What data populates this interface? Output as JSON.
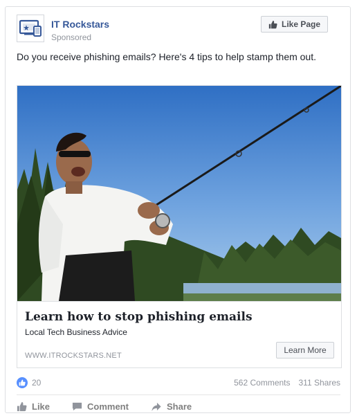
{
  "post": {
    "page_name": "IT Rockstars",
    "sponsored_label": "Sponsored",
    "like_page_label": "Like Page",
    "text": "Do you receive phishing emails? Here's 4 tips to help stamp them out."
  },
  "link_preview": {
    "title": "Learn how to stop phishing emails",
    "description": "Local Tech Business Advice",
    "domain": "WWW.ITROCKSTARS.NET",
    "cta_label": "Learn More"
  },
  "stats": {
    "likes": "20",
    "comments": "562 Comments",
    "shares": "311 Shares"
  },
  "actions": {
    "like": "Like",
    "comment": "Comment",
    "share": "Share"
  },
  "colors": {
    "link_blue": "#365899",
    "like_blue": "#5890ff",
    "muted_gray": "#90949c",
    "border": "#dddfe2"
  },
  "icons": [
    "devices-logo-icon",
    "thumbs-up-icon",
    "comment-icon",
    "share-arrow-icon"
  ]
}
